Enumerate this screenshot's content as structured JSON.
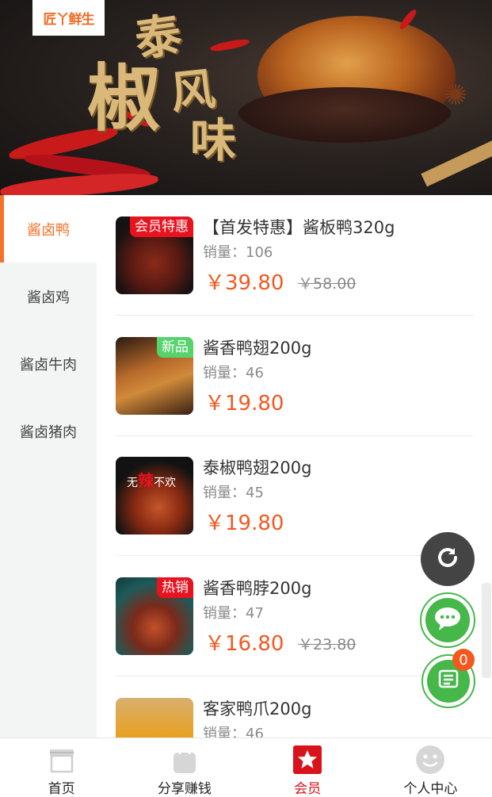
{
  "banner": {
    "logo_text": "匠丫鲜生",
    "headline": [
      "泰",
      "椒",
      "风",
      "味"
    ]
  },
  "sidebar": {
    "items": [
      {
        "label": "酱卤鸭",
        "active": true
      },
      {
        "label": "酱卤鸡",
        "active": false
      },
      {
        "label": "酱卤牛肉",
        "active": false
      },
      {
        "label": "酱卤猪肉",
        "active": false
      }
    ]
  },
  "products": [
    {
      "name": "【首发特惠】酱板鸭320g",
      "sales_label": "销量：",
      "sales": "106",
      "price": "￥39.80",
      "old_price": "￥58.00",
      "tag": "会员特惠",
      "tag_color": "#e8131f"
    },
    {
      "name": "酱香鸭翅200g",
      "sales_label": "销量：",
      "sales": "46",
      "price": "￥19.80",
      "old_price": "",
      "tag": "新品",
      "tag_color": "#57d36d"
    },
    {
      "name": "泰椒鸭翅200g",
      "sales_label": "销量：",
      "sales": "45",
      "price": "￥19.80",
      "old_price": "",
      "tag": "",
      "image_text_prefix": "无",
      "image_text_highlight": "辣",
      "image_text_suffix": "不欢"
    },
    {
      "name": "酱香鸭脖200g",
      "sales_label": "销量：",
      "sales": "47",
      "price": "￥16.80",
      "old_price": "￥23.80",
      "tag": "热销",
      "tag_color": "#e8131f"
    },
    {
      "name": "客家鸭爪200g",
      "sales_label": "销量：",
      "sales": "46",
      "price": "",
      "old_price": "",
      "tag": ""
    }
  ],
  "floating": {
    "refresh_icon": "refresh-icon",
    "chat_icon": "chat-bubble-icon",
    "cart_icon": "cart-list-icon",
    "cart_count": "0"
  },
  "tabbar": {
    "tabs": [
      {
        "label": "首页",
        "icon": "store-icon",
        "active": false
      },
      {
        "label": "分享赚钱",
        "icon": "shopping-bag-icon",
        "active": false
      },
      {
        "label": "会员",
        "icon": "member-star-icon",
        "active": true
      },
      {
        "label": "个人中心",
        "icon": "smiley-icon",
        "active": false
      }
    ]
  },
  "colors": {
    "accent": "#f4732a",
    "price": "#f4581f",
    "tab_active": "#d8131c",
    "fab_green": "#46b749"
  }
}
